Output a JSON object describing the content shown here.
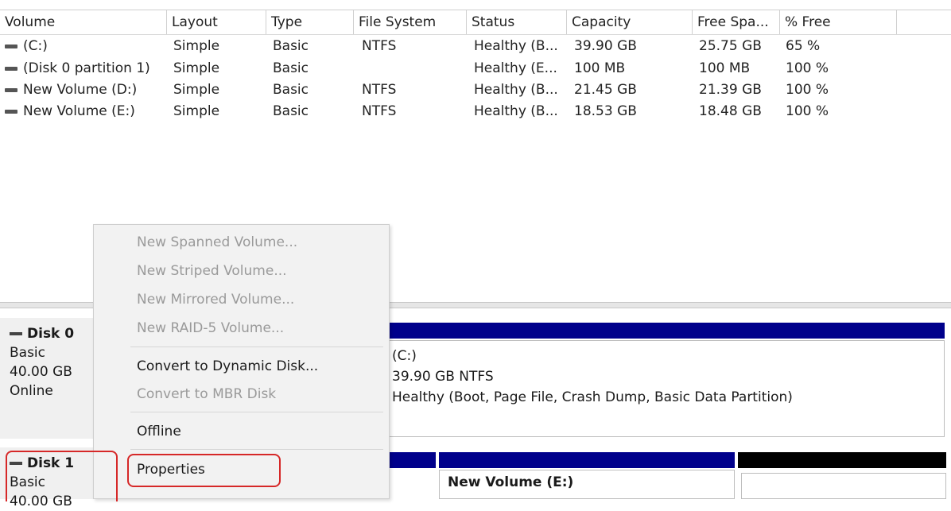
{
  "table": {
    "headers": [
      "Volume",
      "Layout",
      "Type",
      "File System",
      "Status",
      "Capacity",
      "Free Spa...",
      "% Free"
    ],
    "rows": [
      {
        "volume": "(C:)",
        "layout": "Simple",
        "type": "Basic",
        "fs": "NTFS",
        "status": "Healthy (B...",
        "capacity": "39.90 GB",
        "free": "25.75 GB",
        "pct": "65 %"
      },
      {
        "volume": "(Disk 0 partition 1)",
        "layout": "Simple",
        "type": "Basic",
        "fs": "",
        "status": "Healthy (E...",
        "capacity": "100 MB",
        "free": "100 MB",
        "pct": "100 %"
      },
      {
        "volume": "New Volume (D:)",
        "layout": "Simple",
        "type": "Basic",
        "fs": "NTFS",
        "status": "Healthy (B...",
        "capacity": "21.45 GB",
        "free": "21.39 GB",
        "pct": "100 %"
      },
      {
        "volume": "New Volume (E:)",
        "layout": "Simple",
        "type": "Basic",
        "fs": "NTFS",
        "status": "Healthy (B...",
        "capacity": "18.53 GB",
        "free": "18.48 GB",
        "pct": "100 %"
      }
    ]
  },
  "disks": [
    {
      "name": "Disk 0",
      "type": "Basic",
      "size": "40.00 GB",
      "state": "Online"
    },
    {
      "name": "Disk 1",
      "type": "Basic",
      "size": "40.00 GB"
    }
  ],
  "disk0_partition": {
    "name": "(C:)",
    "size": "39.90 GB NTFS",
    "status": "Healthy (Boot, Page File, Crash Dump, Basic Data Partition)"
  },
  "disk1_partition": {
    "name": "New Volume  (E:)"
  },
  "context_menu": {
    "items": [
      {
        "label": "New Spanned Volume...",
        "enabled": false
      },
      {
        "label": "New Striped Volume...",
        "enabled": false
      },
      {
        "label": "New Mirrored Volume...",
        "enabled": false
      },
      {
        "label": "New RAID-5 Volume...",
        "enabled": false
      },
      {
        "label": "Convert to Dynamic Disk...",
        "enabled": true
      },
      {
        "label": "Convert to MBR Disk",
        "enabled": false
      },
      {
        "label": "Offline",
        "enabled": true
      },
      {
        "label": "Properties",
        "enabled": true
      }
    ]
  },
  "colors": {
    "partition_bar": "#00008b",
    "unallocated_bar": "#000000",
    "highlight": "#d62828"
  }
}
